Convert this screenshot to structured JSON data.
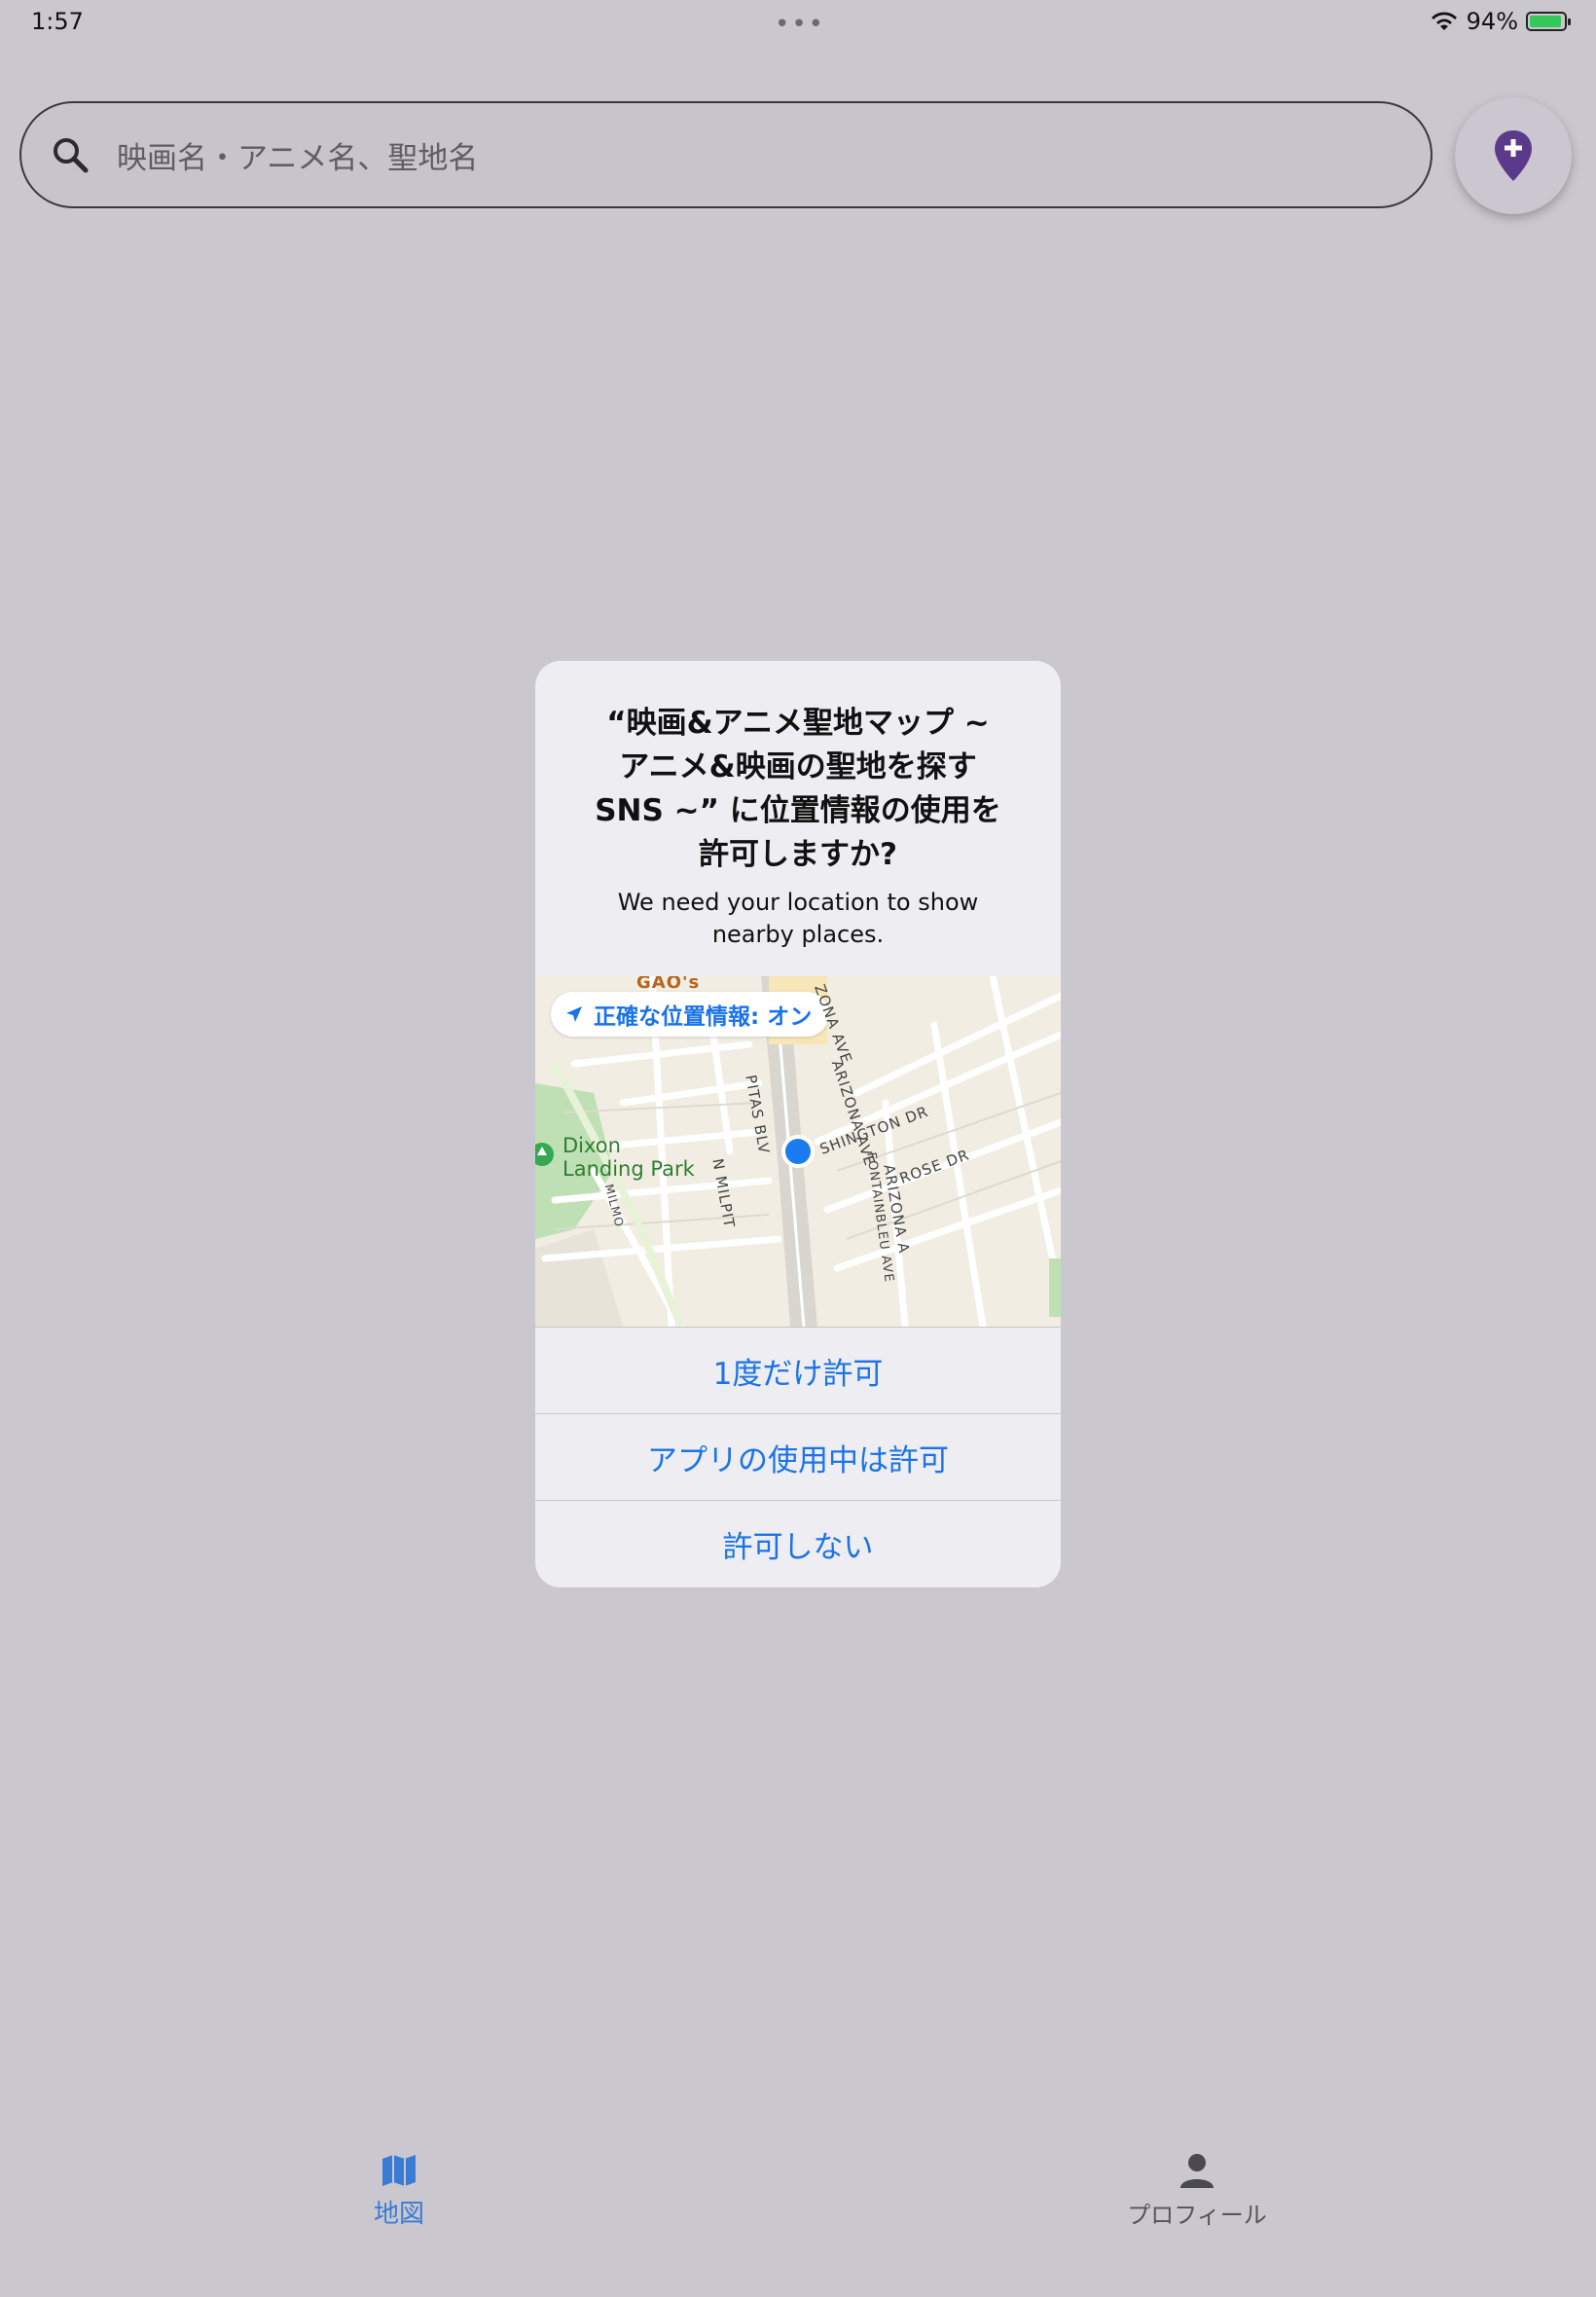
{
  "status_bar": {
    "time": "1:57",
    "dots": "•••",
    "battery_percent": "94%",
    "battery_level": 0.94,
    "wifi_icon": "wifi-icon",
    "battery_icon": "battery-charging-icon"
  },
  "search": {
    "placeholder": "映画名・アニメ名、聖地名",
    "icon": "search-icon"
  },
  "fab": {
    "icon": "add-location-icon",
    "color": "#5b3a8c"
  },
  "dialog": {
    "title": "“映画&アニメ聖地マップ ~ アニメ&映画の聖地を探す SNS ~” に位置情報の使用を許可しますか?",
    "message": "We need your location to show nearby places.",
    "precise_location": "正確な位置情報: オン",
    "map_labels": {
      "park": "Dixon Landing Park",
      "gaos": "GAO's",
      "street1": "PITAS BLV",
      "street2": "SHINGTON DR",
      "street3": "FONTAINBLEU AVE",
      "street4": "ROSE DR",
      "street5": "ZONA AVE",
      "street6": "ARIZONA AVE",
      "street7": "ARIZONA A",
      "street8": "N MILPIT",
      "street9": "MILMO"
    },
    "buttons": {
      "once": "1度だけ許可",
      "while_using": "アプリの使用中は許可",
      "deny": "許可しない"
    },
    "accent": "#1a73e8"
  },
  "bottom_nav": {
    "items": [
      {
        "label": "地図",
        "icon": "map-icon",
        "active": true
      },
      {
        "label": "プロフィール",
        "icon": "person-icon",
        "active": false
      }
    ]
  }
}
